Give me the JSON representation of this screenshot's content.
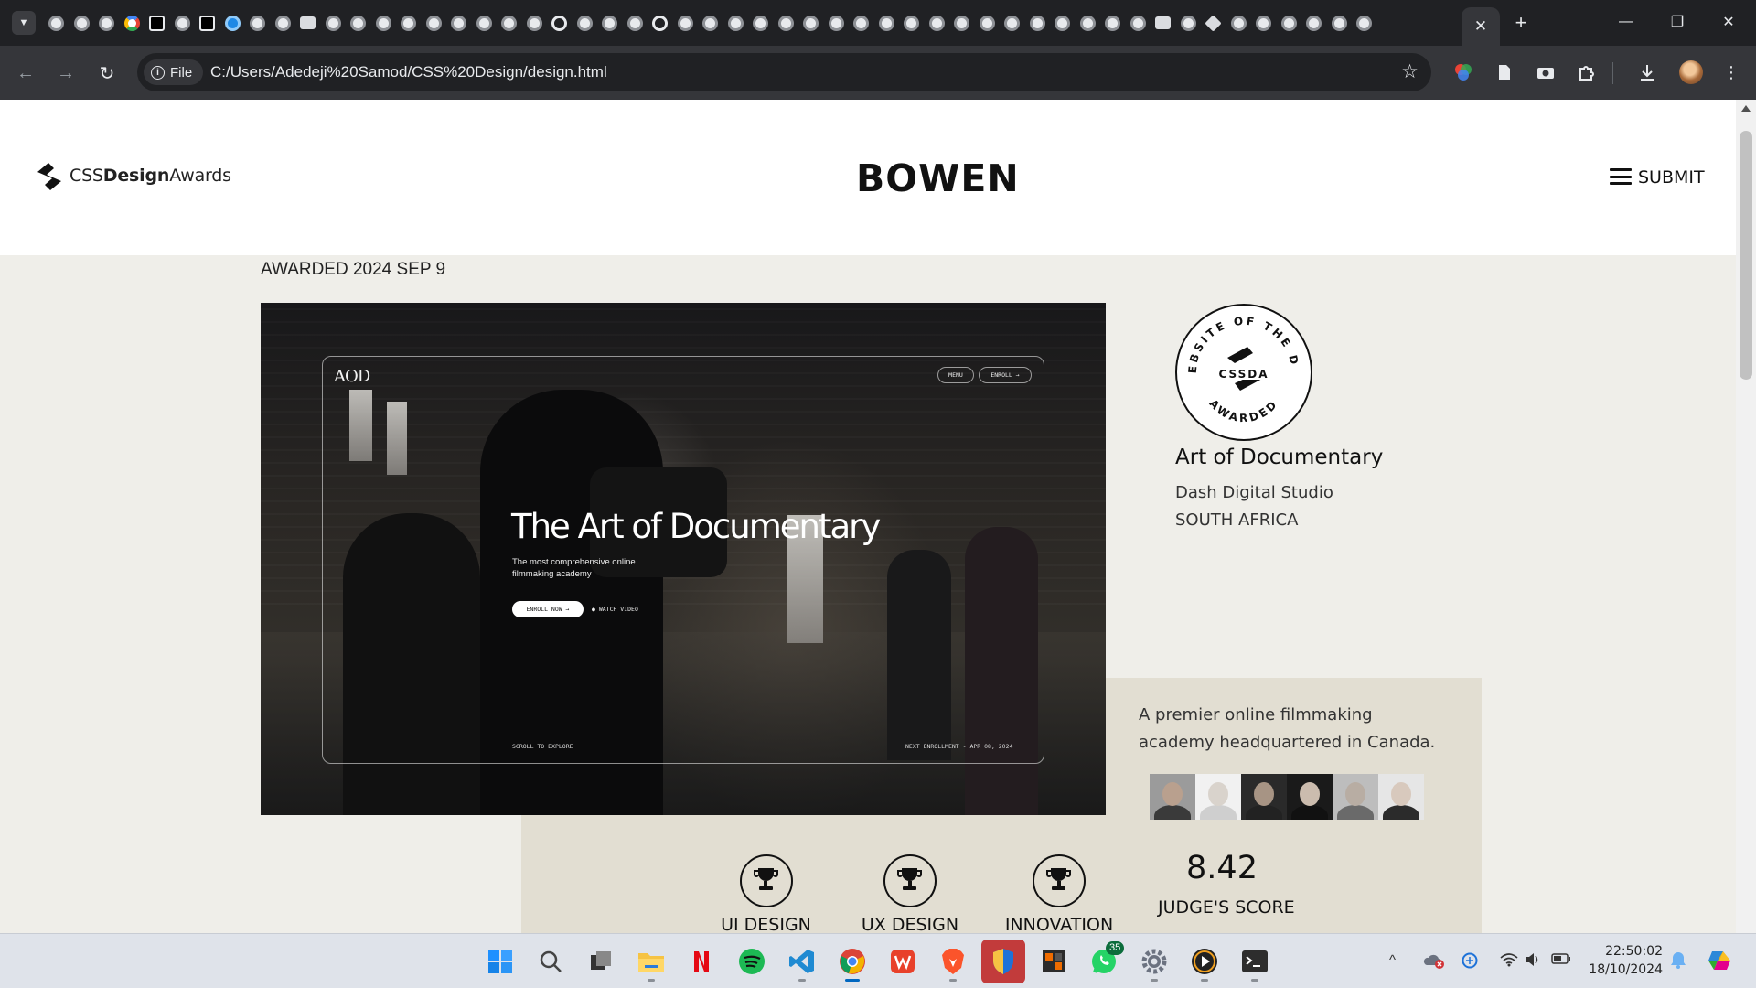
{
  "browser": {
    "tab_count_icons": [
      "globe",
      "globe",
      "globe",
      "google",
      "dark",
      "globe",
      "dark",
      "edge",
      "globe",
      "globe",
      "camera",
      "globe",
      "globe",
      "globe",
      "globe",
      "globe",
      "chrome",
      "globe",
      "globe",
      "globe",
      "github",
      "globe",
      "globe",
      "globe",
      "openai",
      "globe",
      "globe",
      "globe",
      "chrome",
      "globe",
      "globe",
      "chrome",
      "globe",
      "globe",
      "globe",
      "globe",
      "globe",
      "globe",
      "globe",
      "globe",
      "globe",
      "globe",
      "globe",
      "globe",
      "camera",
      "globe",
      "puzzle",
      "globe",
      "globe",
      "globe",
      "globe",
      "globe",
      "globe"
    ],
    "active_tab_close": "✕",
    "new_tab": "+",
    "window_controls": {
      "minimize": "—",
      "restore": "❐",
      "close": "✕"
    },
    "address": {
      "chip_label": "File",
      "url": "C:/Users/Adedeji%20Samod/CSS%20Design/design.html"
    }
  },
  "site": {
    "logo": {
      "prefix": "CSS",
      "bold": "Design",
      "suffix": "Awards"
    },
    "brand": "BOWEN",
    "menu_label": "SUBMIT",
    "awarded_date": "AWARDED 2024 SEP 9",
    "hero": {
      "logo": "AOD",
      "menu_btn": "MENU",
      "enroll_btn": "ENROLL →",
      "title": "The Art of Documentary",
      "subtitle": "The most comprehensive online filmmaking academy",
      "cta": "ENROLL NOW →",
      "watch": "● WATCH VIDEO",
      "scroll": "SCROLL TO EXPLORE",
      "next": "NEXT ENROLLMENT - APR 08, 2024"
    },
    "badge": {
      "ring_top": "WEBSITE OF THE DAY",
      "ring_bottom": "AWARDED",
      "center": "CSSDA"
    },
    "title": "Art of Documentary",
    "studio": "Dash Digital Studio",
    "country": "SOUTH AFRICA",
    "description": "A premier online filmmaking academy headquartered in Canada.",
    "judges": [
      {
        "skin": "#b9a08e",
        "shirt": "#3a3a3a",
        "bg": "#9b9b9b"
      },
      {
        "skin": "#d9d3cc",
        "shirt": "#cfcfcf",
        "bg": "#f1f1f1"
      },
      {
        "skin": "#a79484",
        "shirt": "#222222",
        "bg": "#2a2a2a"
      },
      {
        "skin": "#cbbcae",
        "shirt": "#111111",
        "bg": "#1a1a1a"
      },
      {
        "skin": "#b8ada3",
        "shirt": "#6a6a6a",
        "bg": "#bdbdbd"
      },
      {
        "skin": "#d8c9bd",
        "shirt": "#2b2b2b",
        "bg": "#e6e6e6"
      }
    ],
    "awards": [
      "UI DESIGN",
      "UX DESIGN",
      "INNOVATION"
    ],
    "score": {
      "value": "8.42",
      "label": "JUDGE'S SCORE"
    }
  },
  "taskbar": {
    "apps": [
      "windows-start",
      "search",
      "task-view",
      "file-explorer",
      "netflix",
      "spotify",
      "vscode",
      "chrome",
      "wps-office",
      "brave",
      "security",
      "sublime",
      "whatsapp",
      "settings",
      "media-player",
      "terminal"
    ],
    "whatsapp_badge": "35",
    "time": "22:50:02",
    "date": "18/10/2024"
  }
}
